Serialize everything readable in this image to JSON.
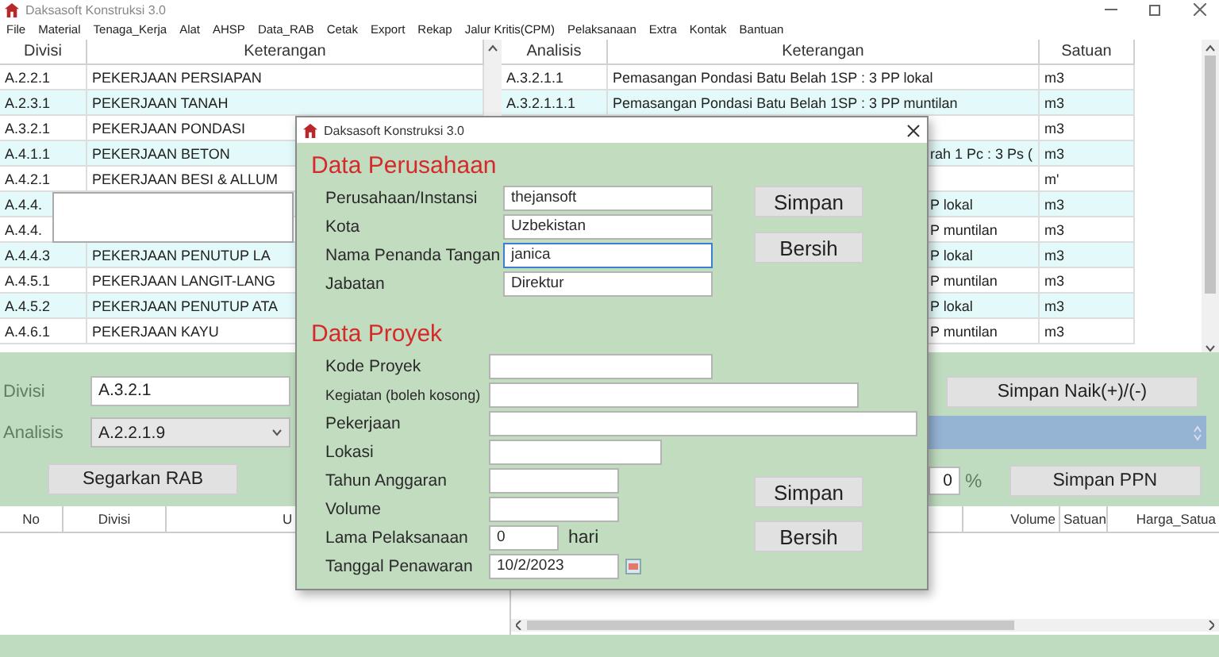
{
  "window": {
    "title": "Daksasoft Konstruksi 3.0"
  },
  "menu": [
    "File",
    "Material",
    "Tenaga_Kerja",
    "Alat",
    "AHSP",
    "Data_RAB",
    "Cetak",
    "Export",
    "Rekap",
    "Jalur Kritis(CPM)",
    "Pelaksanaan",
    "Extra",
    "Kontak",
    "Bantuan"
  ],
  "divisi_table": {
    "columns": [
      "Divisi",
      "Keterangan"
    ],
    "rows": [
      {
        "divisi": "A.2.2.1",
        "keterangan": "PEKERJAAN PERSIAPAN"
      },
      {
        "divisi": "A.2.3.1",
        "keterangan": "PEKERJAAN TANAH"
      },
      {
        "divisi": "A.3.2.1",
        "keterangan": "PEKERJAAN PONDASI"
      },
      {
        "divisi": "A.4.1.1",
        "keterangan": "PEKERJAAN BETON"
      },
      {
        "divisi": "A.4.2.1",
        "keterangan": "PEKERJAAN BESI & ALLUM"
      },
      {
        "divisi": "A.4.4."
      },
      {
        "divisi": "A.4.4."
      },
      {
        "divisi": "A.4.4.3",
        "keterangan": "PEKERJAAN PENUTUP LA"
      },
      {
        "divisi": "A.4.5.1",
        "keterangan": "PEKERJAAN LANGIT-LANG"
      },
      {
        "divisi": "A.4.5.2",
        "keterangan": "PEKERJAAN PENUTUP ATA"
      },
      {
        "divisi": "A.4.6.1",
        "keterangan": "PEKERJAAN  KAYU"
      }
    ]
  },
  "analisis_table": {
    "columns": [
      "Analisis",
      "Keterangan",
      "Satuan"
    ],
    "rows": [
      {
        "analisis": "A.3.2.1.1",
        "keterangan": "Pemasangan Pondasi Batu Belah 1SP : 3 PP lokal",
        "satuan": "m3"
      },
      {
        "analisis": "A.3.2.1.1.1",
        "keterangan": "Pemasangan Pondasi Batu Belah 1SP : 3 PP muntilan",
        "satuan": "m3"
      },
      {
        "satuan": "m3"
      },
      {
        "keterangan": "rah 1 Pc : 3 Ps (",
        "satuan": "m3"
      },
      {
        "satuan": "m'"
      },
      {
        "keterangan": "P lokal",
        "satuan": "m3"
      },
      {
        "keterangan": "P muntilan",
        "satuan": "m3"
      },
      {
        "keterangan": "P lokal",
        "satuan": "m3"
      },
      {
        "keterangan": "P muntilan",
        "satuan": "m3"
      },
      {
        "keterangan": "P lokal",
        "satuan": "m3"
      },
      {
        "keterangan": "P muntilan",
        "satuan": "m3"
      }
    ]
  },
  "rab_form": {
    "disabled": true,
    "divisi_label": "Divisi",
    "divisi_value": "A.3.2.1",
    "analisis_label": "Analisis",
    "analisis_value": "A.2.2.1.9",
    "refresh_button": "Segarkan RAB",
    "save_markup_button": "Simpan Naik(+)/(-)",
    "ppn_value": "0",
    "ppn_unit": "%",
    "save_ppn_button": "Simpan PPN"
  },
  "rab_table": {
    "columns": [
      "No",
      "Divisi",
      "U",
      "Volume",
      "Satuan",
      "Harga_Satua"
    ]
  },
  "dialog": {
    "title": "Daksasoft Konstruksi 3.0",
    "company": {
      "heading": "Data Perusahaan",
      "fields": [
        {
          "label": "Perusahaan/Instansi",
          "value": "thejansoft",
          "focused": false,
          "kind": "text"
        },
        {
          "label": "Kota",
          "value": "Uzbekistan",
          "focused": false,
          "kind": "text"
        },
        {
          "label": "Nama Penanda Tangan",
          "value": "janica",
          "focused": true,
          "kind": "text"
        },
        {
          "label": "Jabatan",
          "value": "Direktur",
          "focused": false,
          "kind": "text"
        }
      ],
      "buttons": [
        "Simpan",
        "Bersih"
      ]
    },
    "project": {
      "heading": "Data Proyek",
      "fields": [
        {
          "label": "Kode Proyek",
          "focused": false,
          "kind": "text"
        },
        {
          "label": "Kegiatan (boleh kosong)",
          "focused": false,
          "kind": "text"
        },
        {
          "label": "Pekerjaan",
          "focused": false,
          "kind": "text"
        },
        {
          "label": "Lokasi",
          "focused": false,
          "kind": "text"
        },
        {
          "label": "Tahun Anggaran",
          "focused": false,
          "kind": "text"
        },
        {
          "label": "Volume",
          "focused": false,
          "kind": "text"
        },
        {
          "label": "Lama Pelaksanaan",
          "value": "0",
          "unit": "hari",
          "focused": false,
          "kind": "days"
        },
        {
          "label": "Tanggal Penawaran",
          "value": "10/2/2023",
          "focused": false,
          "kind": "date"
        }
      ],
      "buttons": [
        "Simpan",
        "Bersih"
      ]
    }
  }
}
